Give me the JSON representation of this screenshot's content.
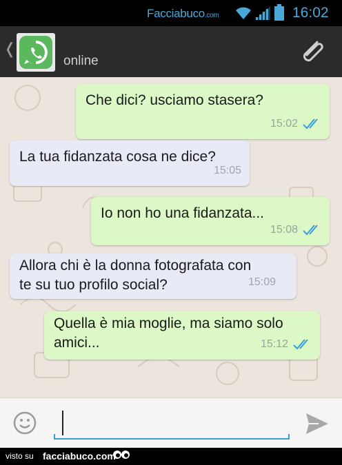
{
  "status_bar": {
    "brand": "Facciabuco",
    "brand_suffix": ".com",
    "time": "16:02",
    "icons": [
      "wifi-icon",
      "signal-icon",
      "battery-icon"
    ],
    "accent_color": "#4aa8d8"
  },
  "header": {
    "back_icon": "chevron-left-icon",
    "avatar_icon": "whatsapp-logo",
    "status": "online",
    "attach_icon": "paperclip-icon",
    "background": "#2b2b2b"
  },
  "messages": [
    {
      "direction": "outgoing",
      "text": "Che dici? usciamo stasera?",
      "time": "15:02",
      "read": true
    },
    {
      "direction": "incoming",
      "text": "La tua fidanzata cosa ne dice?",
      "time": "15:05"
    },
    {
      "direction": "outgoing",
      "text": "Io non ho una fidanzata...",
      "time": "15:08",
      "read": true
    },
    {
      "direction": "incoming",
      "text_line1": "Allora chi è la donna fotografata con",
      "text_line2": "te su tuo profilo social?",
      "time": "15:09"
    },
    {
      "direction": "outgoing",
      "text_line1": "Quella è mia moglie, ma siamo solo",
      "text_line2": "amici...",
      "time": "15:12",
      "read": true
    }
  ],
  "colors": {
    "outgoing_bubble": "#dcf8c6",
    "incoming_bubble": "#e8eaf6",
    "read_ticks": "#3b9ad9",
    "chat_background": "#ece5dd"
  },
  "input_bar": {
    "emoji_icon": "smiley-icon",
    "value": "",
    "send_icon": "send-icon"
  },
  "footer": {
    "label": "visto su",
    "site": "facciabuco.com",
    "icon": "eyes-icon"
  }
}
